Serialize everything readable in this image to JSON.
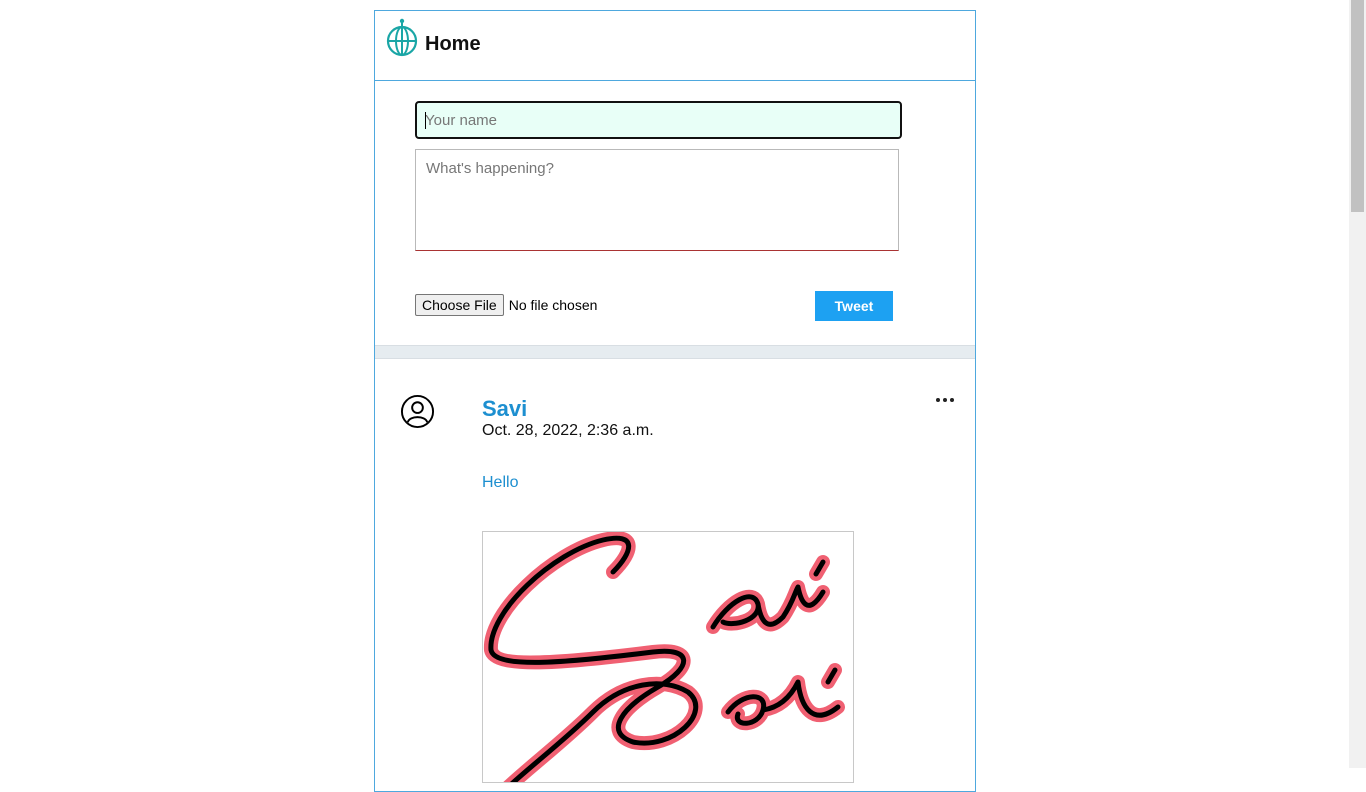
{
  "header": {
    "title": "Home",
    "logo_icon": "globe-pin-icon"
  },
  "composer": {
    "name_placeholder": "Your name",
    "name_value": "",
    "text_placeholder": "What's happening?",
    "text_value": "",
    "choose_file_label": "Choose File",
    "file_status": "No file chosen",
    "tweet_label": "Tweet"
  },
  "post": {
    "avatar_icon": "user-circle-icon",
    "author": "Savi",
    "timestamp": "Oct. 28, 2022, 2:36 a.m.",
    "text": "Hello",
    "more_icon": "ellipsis-icon",
    "image_signature_text": "Savi"
  },
  "colors": {
    "accent": "#1da1f2",
    "link": "#1d8fd0",
    "border": "#4ea8de",
    "input_bg": "#e8fff7",
    "logo": "#1aa6a6",
    "signature_outline": "#f06072"
  }
}
